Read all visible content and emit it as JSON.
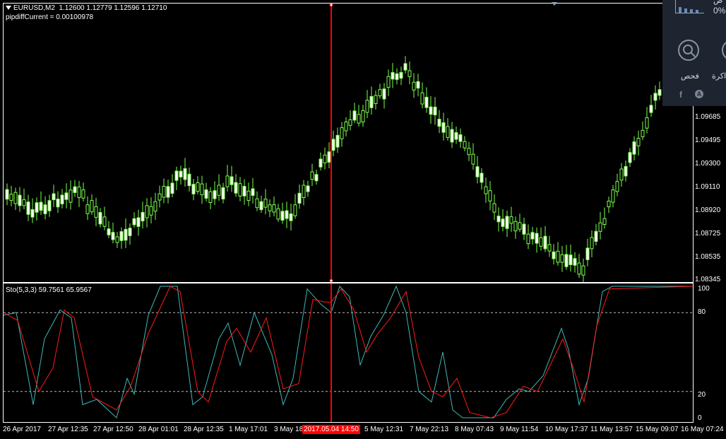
{
  "chart_header": {
    "symbol": "EURUSD,M2",
    "ohlc": "1.12600 1.12779 1.12596 1.12710",
    "pipdiff": "pipdiffCurrent = 0.00100978"
  },
  "oscillator_header": "Sto(5,3,3) 59.7561 65.9567",
  "price_axis": [
    "1.09685",
    "1.09495",
    "1.09300",
    "1.09110",
    "1.08920",
    "1.08725",
    "1.08535",
    "1.08345"
  ],
  "osc_axis": [
    "100",
    "80",
    "20",
    "0"
  ],
  "time_axis": [
    "26 Apr 2017",
    "27 Apr 12:35",
    "27 Apr 12:50",
    "28 Apr 01:01",
    "28 Apr 12:35",
    "1 May 17:01",
    "3 May 18",
    "5 May 12:31",
    "7 May 22:13",
    "8 May 07:43",
    "9 May 11:54",
    "10 May 17:37",
    "11 May 13:57",
    "15 May 09:07",
    "16 May 07:24"
  ],
  "crosshair_time": "2017.05.04 14:50",
  "overlay": {
    "percent": "0%",
    "scan_label": "فحص",
    "memory_label": "ذاكرة",
    "top_text": "ص"
  },
  "colors": {
    "candle": "#7cff4c",
    "crosshair": "#ff0000",
    "stoch_main": "#3fb8b8",
    "stoch_signal": "#ff1a1a",
    "background": "#000000"
  },
  "icons": [
    "search-icon",
    "facebook-icon",
    "account-icon",
    "chart-icon"
  ]
}
